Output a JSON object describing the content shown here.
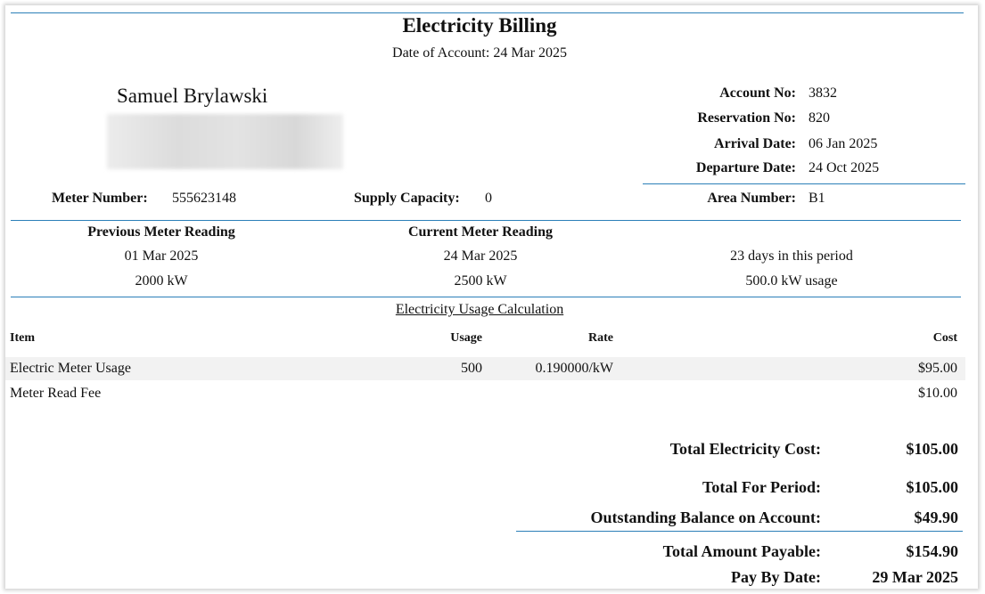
{
  "header": {
    "title": "Electricity Billing",
    "date_label": "Date of Account:",
    "date_value": "24 Mar 2025"
  },
  "customer": {
    "name": "Samuel Brylawski"
  },
  "account": {
    "account_no_label": "Account No:",
    "account_no": "3832",
    "reservation_no_label": "Reservation No:",
    "reservation_no": "820",
    "arrival_label": "Arrival Date:",
    "arrival": "06 Jan 2025",
    "departure_label": "Departure Date:",
    "departure": "24 Oct 2025"
  },
  "meter": {
    "meter_number_label": "Meter Number:",
    "meter_number": "555623148",
    "supply_capacity_label": "Supply Capacity:",
    "supply_capacity": "0",
    "area_number_label": "Area Number:",
    "area_number": "B1"
  },
  "readings": {
    "previous_label": "Previous Meter Reading",
    "previous_date": "01 Mar 2025",
    "previous_value": "2000 kW",
    "current_label": "Current Meter Reading",
    "current_date": "24 Mar 2025",
    "current_value": "2500 kW",
    "days": "23 days in this period",
    "usage": "500.0 kW usage"
  },
  "calculation": {
    "title": "Electricity Usage Calculation",
    "columns": [
      "Item",
      "Usage",
      "Rate",
      "Cost"
    ],
    "rows": [
      {
        "item": "Electric Meter Usage",
        "usage": "500",
        "rate": "0.190000/kW",
        "cost": "$95.00"
      },
      {
        "item": "Meter Read Fee",
        "usage": "",
        "rate": "",
        "cost": "$10.00"
      }
    ]
  },
  "totals": {
    "electricity_cost_label": "Total Electricity Cost:",
    "electricity_cost": "$105.00",
    "period_label": "Total For Period:",
    "period": "$105.00",
    "outstanding_label": "Outstanding Balance on Account:",
    "outstanding": "$49.90",
    "payable_label": "Total Amount Payable:",
    "payable": "$154.90",
    "pay_by_label": "Pay By Date:",
    "pay_by": "29 Mar 2025"
  },
  "colors": {
    "rule": "#2b7fb8",
    "row_shade": "#f2f2f2"
  }
}
